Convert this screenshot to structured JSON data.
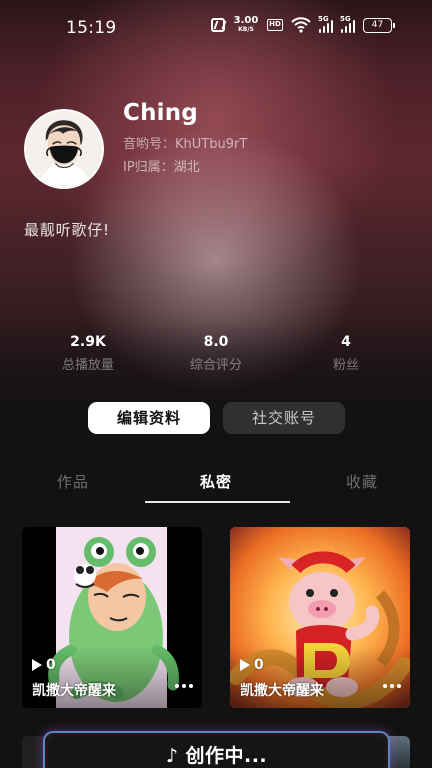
{
  "status_bar": {
    "time": "15:19",
    "network_speed": "3.00",
    "network_speed_unit": "KB/S",
    "hd_label": "HD",
    "signal_label_1": "5G",
    "signal_label_2": "5G",
    "battery": "47",
    "icons": [
      "nfc-icon",
      "hd-icon",
      "wifi-icon",
      "signal-icon",
      "battery-icon"
    ]
  },
  "profile": {
    "name": "Ching",
    "music_id": "音哟号：KhUTbu9rT",
    "ip_location": "IP归属：湖北",
    "bio": "最靓听歌仔!"
  },
  "stats": [
    {
      "value": "2.9K",
      "label": "总播放量"
    },
    {
      "value": "8.0",
      "label": "综合评分"
    },
    {
      "value": "4",
      "label": "粉丝"
    }
  ],
  "actions": {
    "edit_profile": "编辑资料",
    "social_account": "社交账号"
  },
  "tabs": {
    "works": "作品",
    "private": "私密",
    "favorites": "收藏",
    "active": "私密"
  },
  "cards": [
    {
      "plays": "0",
      "title": "凯撒大帝醒来",
      "icon": "play-icon",
      "menu_icon": "more-icon"
    },
    {
      "plays": "0",
      "title": "凯撒大帝醒来",
      "icon": "play-icon",
      "menu_icon": "more-icon"
    }
  ],
  "creating": {
    "icon": "music-note-icon",
    "note": "♪",
    "label": "创作中..."
  },
  "colors": {
    "background": "#121212",
    "active_text": "#ffffff",
    "inactive_text": "rgba(255,255,255,0.38)",
    "creating_border": "#78b4ff"
  }
}
